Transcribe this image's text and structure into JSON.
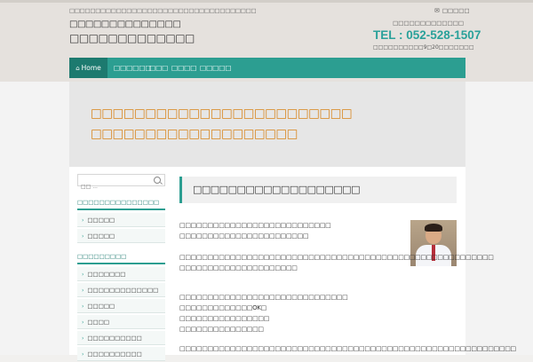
{
  "header": {
    "tagline": "□□□□□□□□□□□□□□□□□□□□□□□□□□□□□□□□□□□□",
    "site_subtitle": "□□□□□□□□□□□□□□",
    "site_title": "□□□□□□□□□□□□□",
    "contact_link": "□□□□□",
    "tel_label": "□□□□□□□□□□□□□",
    "tel": "TEL : 052-528-1507",
    "hours": "□□□□□□□□□□9□20□□□□□□□"
  },
  "nav": {
    "items": [
      {
        "label": "Home",
        "icon": "home-icon"
      },
      {
        "label": "□□□□□□"
      },
      {
        "label": "□□□"
      },
      {
        "label": "□□□□"
      },
      {
        "label": "□□□□□"
      }
    ]
  },
  "hero": {
    "line1": "□□□□□□□□□□□□□□□□□□□□□□□□",
    "line2": "□□□□□□□□□□□□□□□□□□□"
  },
  "sidebar": {
    "search_placeholder": "□□ ...",
    "section1_title": "□□□□□□□□□□□□□□□",
    "section1_items": [
      "□□□□□",
      "□□□□□"
    ],
    "section2_title": "□□□□□□□□□",
    "section2_items": [
      "□□□□□□□",
      "□□□□□□□□□□□□□",
      "□□□□□",
      "□□□□",
      "□□□□□□□□□□",
      "□□□□□□□□□□"
    ]
  },
  "content": {
    "title": "□□□□□□□□□□□□□□□□□□□",
    "p1": [
      "□□□□□□□□□□□□□□□□□□□□□□□□□□□",
      "□□□□□□□□□□□□□□□□□□□□□□□"
    ],
    "p2": [
      "□□□□□□□□□□□□□□□□□□□□□□□□□□□□□□□□□□□□□□□□□□□□□□□□□□□□□□□□",
      "□□□□□□□□□□□□□□□□□□□□□"
    ],
    "p3": [
      "□□□□□□□□□□□□□□□□□□□□□□□□□□□□□□",
      "□□□□□□□□□□□□□OK□",
      "□□□□□□□□□□□□□□□□",
      "□□□□□□□□□□□□□□□"
    ],
    "p4": "□□□□□□□□□□□□□□□□□□□□□□□□□□□□□□□□□□□□□□□□□□□□□□□□□□□□□□□□□□□□"
  },
  "colors": {
    "accent": "#2c9e91",
    "hero_text": "#d8841a",
    "tel": "#2aa19a"
  }
}
